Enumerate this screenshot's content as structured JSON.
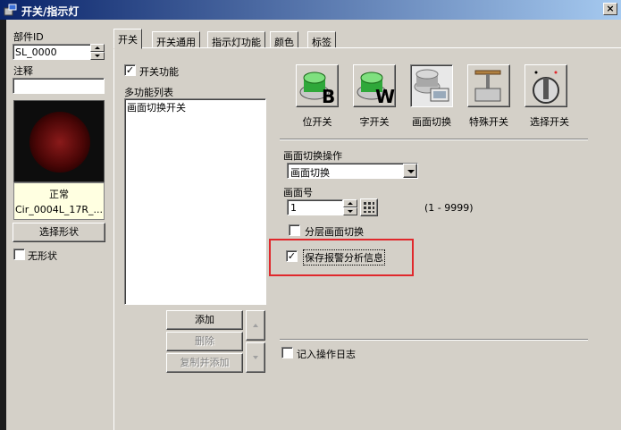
{
  "window": {
    "title": "开关/指示灯",
    "close_glyph": "×"
  },
  "left": {
    "part_id_label": "部件ID",
    "part_id_value": "SL_0000",
    "comment_label": "注释",
    "comment_value": "",
    "status_text": "正常",
    "shape_name": "Cir_0004L_17R_...",
    "select_shape_button": "选择形状",
    "no_shape_label": "无形状"
  },
  "tabs": [
    {
      "label": "开关"
    },
    {
      "label": "开关通用"
    },
    {
      "label": "指示灯功能"
    },
    {
      "label": "颜色"
    },
    {
      "label": "标签"
    }
  ],
  "switch_panel": {
    "switch_function_label": "开关功能",
    "switch_function_checked": true,
    "multi_list_label": "多功能列表",
    "list_items": [
      "画面切换开关"
    ],
    "add_button": "添加",
    "delete_button": "删除",
    "copy_add_button": "复制并添加"
  },
  "switch_types": [
    {
      "label": "位开关",
      "icon": "bit-switch-icon",
      "glyph": "B"
    },
    {
      "label": "字开关",
      "icon": "word-switch-icon",
      "glyph": "W"
    },
    {
      "label": "画面切换",
      "icon": "screen-change-icon",
      "glyph": ""
    },
    {
      "label": "特殊开关",
      "icon": "special-switch-icon",
      "glyph": ""
    },
    {
      "label": "选择开关",
      "icon": "selector-switch-icon",
      "glyph": ""
    }
  ],
  "screen_change": {
    "operation_label": "画面切换操作",
    "operation_value": "画面切换",
    "screen_no_label": "画面号",
    "screen_no_value": "1",
    "range_text": "(1 - 9999)",
    "layered_label": "分层画面切换",
    "layered_checked": false,
    "save_alarm_label": "保存报警分析信息",
    "save_alarm_checked": true,
    "log_label": "记入操作日志",
    "log_checked": false
  },
  "colors": {
    "title_start": "#0a246a",
    "title_end": "#a6caf0",
    "face": "#d4d0c8",
    "highlight": "#e0282c",
    "tooltip": "#ffffe1"
  }
}
